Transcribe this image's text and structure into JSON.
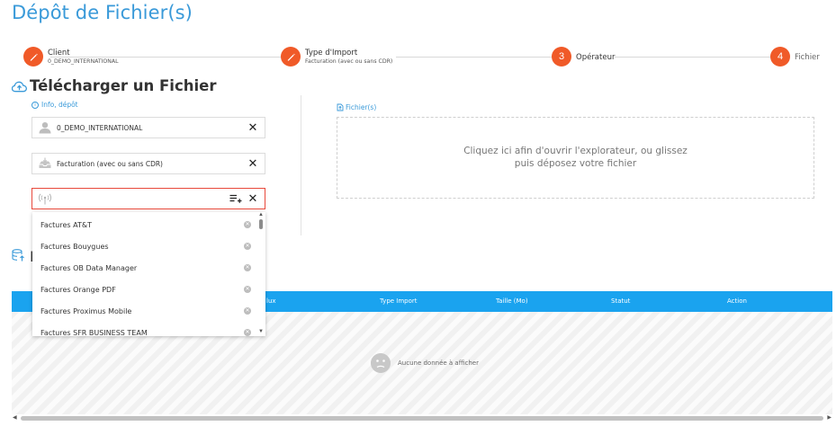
{
  "page": {
    "title": "Dépôt de Fichier(s)"
  },
  "stepper": {
    "steps": [
      {
        "number": "",
        "title": "Client",
        "subtitle": "0_DEMO_INTERNATIONAL",
        "icon": "pencil-icon",
        "completed": true
      },
      {
        "number": "",
        "title": "Type d'Import",
        "subtitle": "Facturation (avec ou sans CDR)",
        "icon": "pencil-icon",
        "completed": true
      },
      {
        "number": "3",
        "title": "Opérateur",
        "subtitle": ""
      },
      {
        "number": "4",
        "title": "Fichier",
        "subtitle": ""
      }
    ],
    "accent_color": "#f05a28"
  },
  "upload": {
    "title": "Télécharger un Fichier",
    "info_link": "Info, dépôt",
    "client_field": {
      "value": "0_DEMO_INTERNATIONAL",
      "icon": "user-icon"
    },
    "import_type_field": {
      "value": "Facturation (avec ou sans CDR)",
      "icon": "inbox-tray-icon"
    },
    "operator_field": {
      "value": "",
      "icon": "antenna-icon"
    },
    "operator_options": [
      "Factures AT&T",
      "Factures Bouygues",
      "Factures OB Data Manager",
      "Factures Orange PDF",
      "Factures Proximus Mobile",
      "Factures SFR BUSINESS TEAM"
    ],
    "files_label": "Fichier(s)",
    "dropzone_text": "Cliquez ici afin d'ouvrir l'explorateur, ou glissez puis déposez votre fichier"
  },
  "history": {
    "title_fragment": "I",
    "columns": [
      "lux",
      "Type Import",
      "Taille (Mo)",
      "Statut",
      "Action"
    ],
    "empty_message": "Aucune donnée à afficher",
    "header_color": "#1aa3ef"
  },
  "brand_color": "#3a9ad9"
}
